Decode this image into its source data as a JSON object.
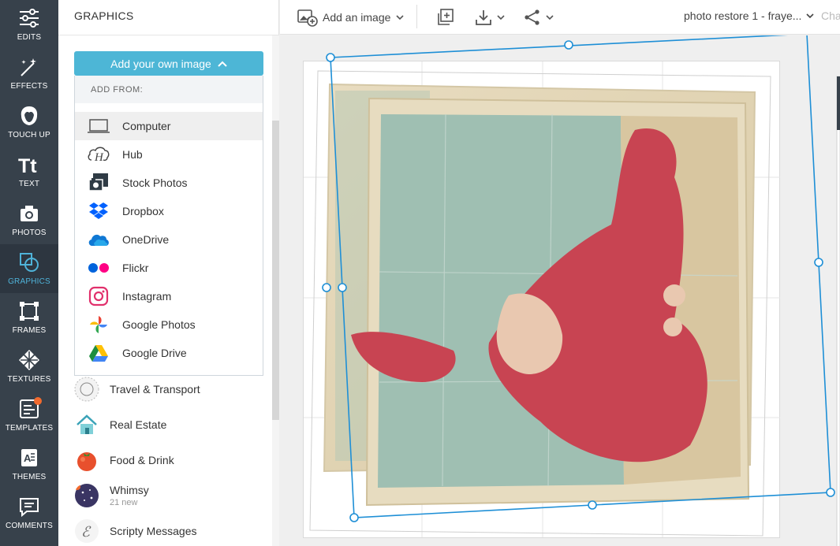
{
  "rail": {
    "items": [
      {
        "label": "EDITS",
        "icon": "sliders-icon"
      },
      {
        "label": "EFFECTS",
        "icon": "magic-wand-icon"
      },
      {
        "label": "TOUCH UP",
        "icon": "face-icon"
      },
      {
        "label": "TEXT",
        "icon": "text-icon"
      },
      {
        "label": "PHOTOS",
        "icon": "photo-camera-icon"
      },
      {
        "label": "GRAPHICS",
        "icon": "shapes-icon",
        "active": true
      },
      {
        "label": "FRAMES",
        "icon": "frame-icon"
      },
      {
        "label": "TEXTURES",
        "icon": "texture-icon"
      },
      {
        "label": "TEMPLATES",
        "icon": "template-icon",
        "badge": true
      },
      {
        "label": "THEMES",
        "icon": "themes-icon"
      },
      {
        "label": "COMMENTS",
        "icon": "comment-icon"
      }
    ]
  },
  "panel": {
    "title": "GRAPHICS",
    "add_button": "Add your own image",
    "add_from_label": "ADD FROM:",
    "sources": [
      {
        "label": "Computer",
        "icon": "laptop-icon"
      },
      {
        "label": "Hub",
        "icon": "hub-icon"
      },
      {
        "label": "Stock Photos",
        "icon": "stock-camera-icon"
      },
      {
        "label": "Dropbox",
        "icon": "dropbox-icon"
      },
      {
        "label": "OneDrive",
        "icon": "onedrive-icon"
      },
      {
        "label": "Flickr",
        "icon": "flickr-icon"
      },
      {
        "label": "Instagram",
        "icon": "instagram-icon"
      },
      {
        "label": "Google Photos",
        "icon": "google-photos-icon"
      },
      {
        "label": "Google Drive",
        "icon": "google-drive-icon"
      }
    ],
    "categories": [
      {
        "name": "Travel & Transport",
        "sub": ""
      },
      {
        "name": "Real Estate",
        "sub": ""
      },
      {
        "name": "Food & Drink",
        "sub": ""
      },
      {
        "name": "Whimsy",
        "sub": "21 new"
      },
      {
        "name": "Scripty Messages",
        "sub": ""
      }
    ]
  },
  "topbar": {
    "add_image": "Add an image",
    "doc_title": "photo restore 1 - fraye...",
    "more": "Cha"
  },
  "colors": {
    "rail_bg": "#37414b",
    "accent": "#4db6d6",
    "selection": "#1e8fd6"
  }
}
